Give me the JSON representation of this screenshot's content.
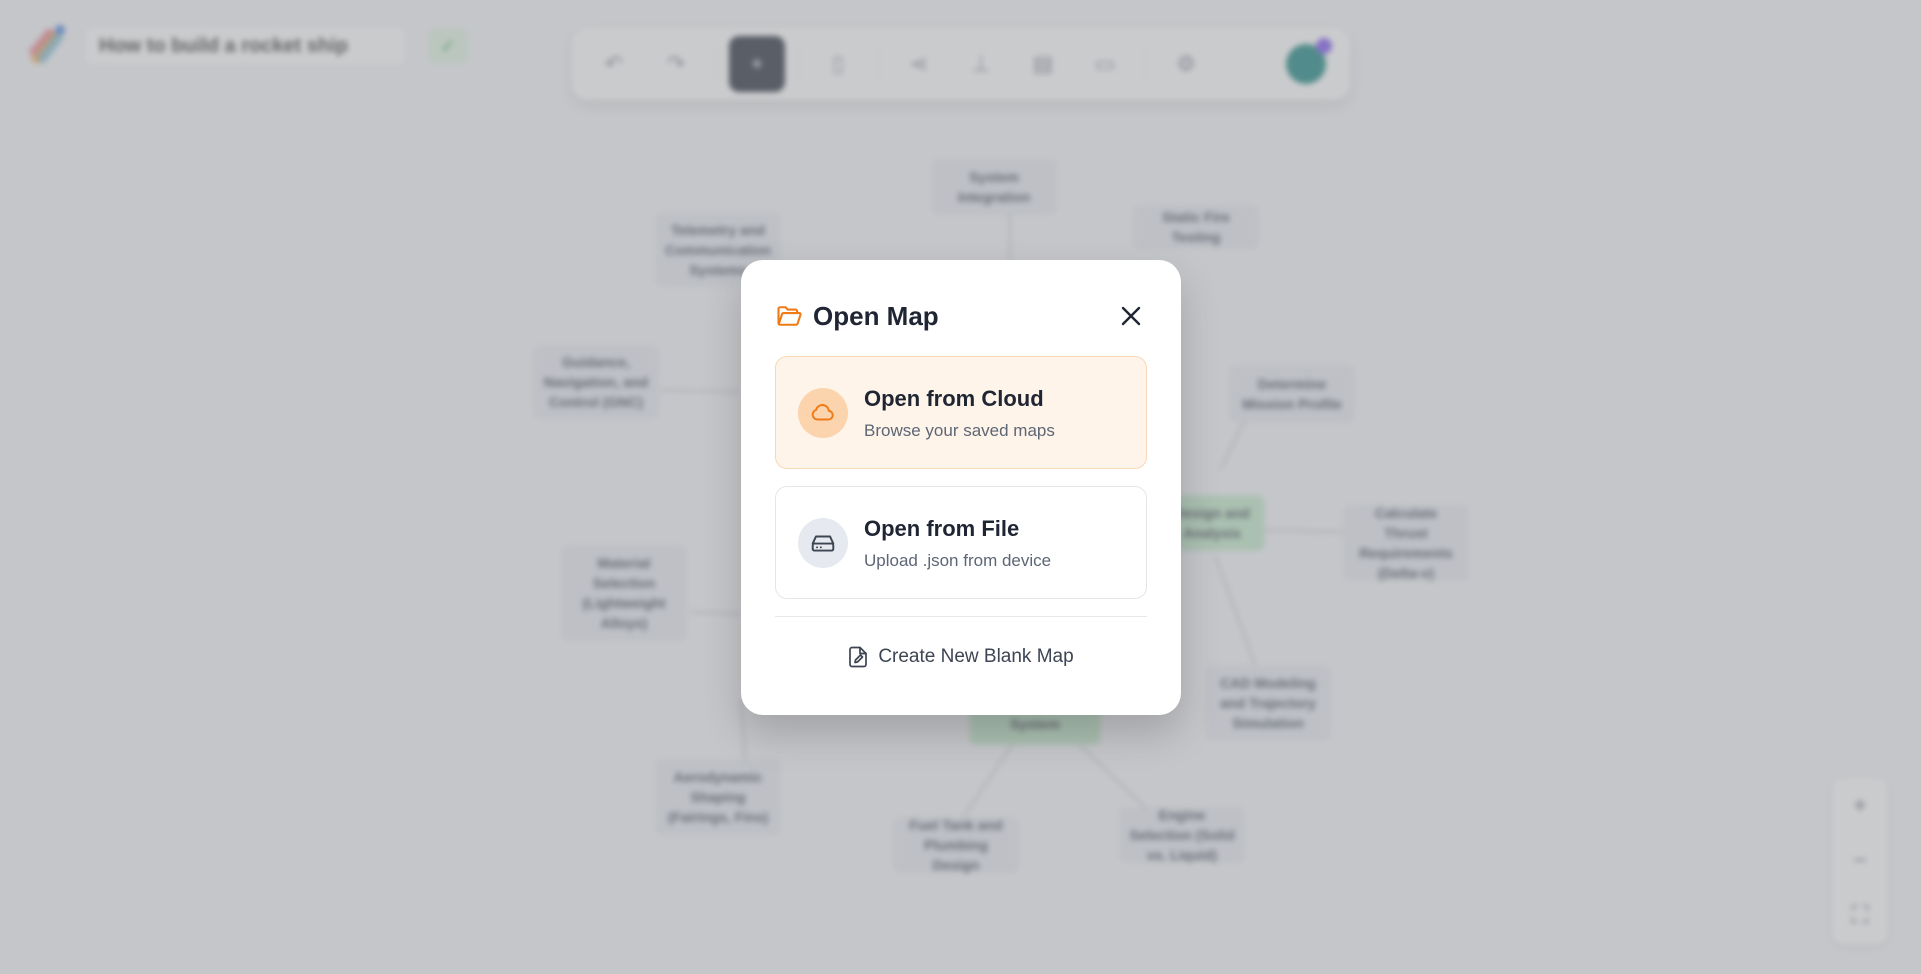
{
  "app": {
    "map_title": "How to build a rocket ship",
    "save_icon": "check-icon",
    "toolbar": {
      "items": [
        "undo-icon",
        "redo-icon",
        "add-node-icon",
        "delete-icon",
        "share-icon",
        "export-icon",
        "save-icon",
        "open-folder-icon",
        "settings-icon"
      ]
    }
  },
  "mindmap": {
    "nodes": [
      {
        "label": "System Integration",
        "green": false
      },
      {
        "label": "Static Fire Testing",
        "green": false
      },
      {
        "label": "Telemetry and Communication Systems",
        "green": false
      },
      {
        "label": "Guidance, Navigation, and Control (GNC)",
        "green": false
      },
      {
        "label": "Determine Mission Profile",
        "green": false
      },
      {
        "label": "Design and Analysis",
        "green": true
      },
      {
        "label": "Calculate Thrust Requirements (Delta-v)",
        "green": false
      },
      {
        "label": "Material Selection (Lightweight Alloys)",
        "green": false
      },
      {
        "label": "CAD Modeling and Trajectory Simulation",
        "green": false
      },
      {
        "label": "System",
        "green": true
      },
      {
        "label": "Aerodynamic Shaping (Fairings, Fins)",
        "green": false
      },
      {
        "label": "Fuel Tank and Plumbing Design",
        "green": false
      },
      {
        "label": "Engine Selection (Solid vs. Liquid)",
        "green": false
      }
    ]
  },
  "modal": {
    "title": "Open Map",
    "cloud": {
      "title": "Open from Cloud",
      "subtitle": "Browse your saved maps"
    },
    "file": {
      "title": "Open from File",
      "subtitle": "Upload .json from device"
    },
    "new_blank": "Create New Blank Map"
  },
  "colors": {
    "accent": "#f07a16",
    "cloud_bg": "#fff4ea",
    "dark": "#1f2533"
  }
}
